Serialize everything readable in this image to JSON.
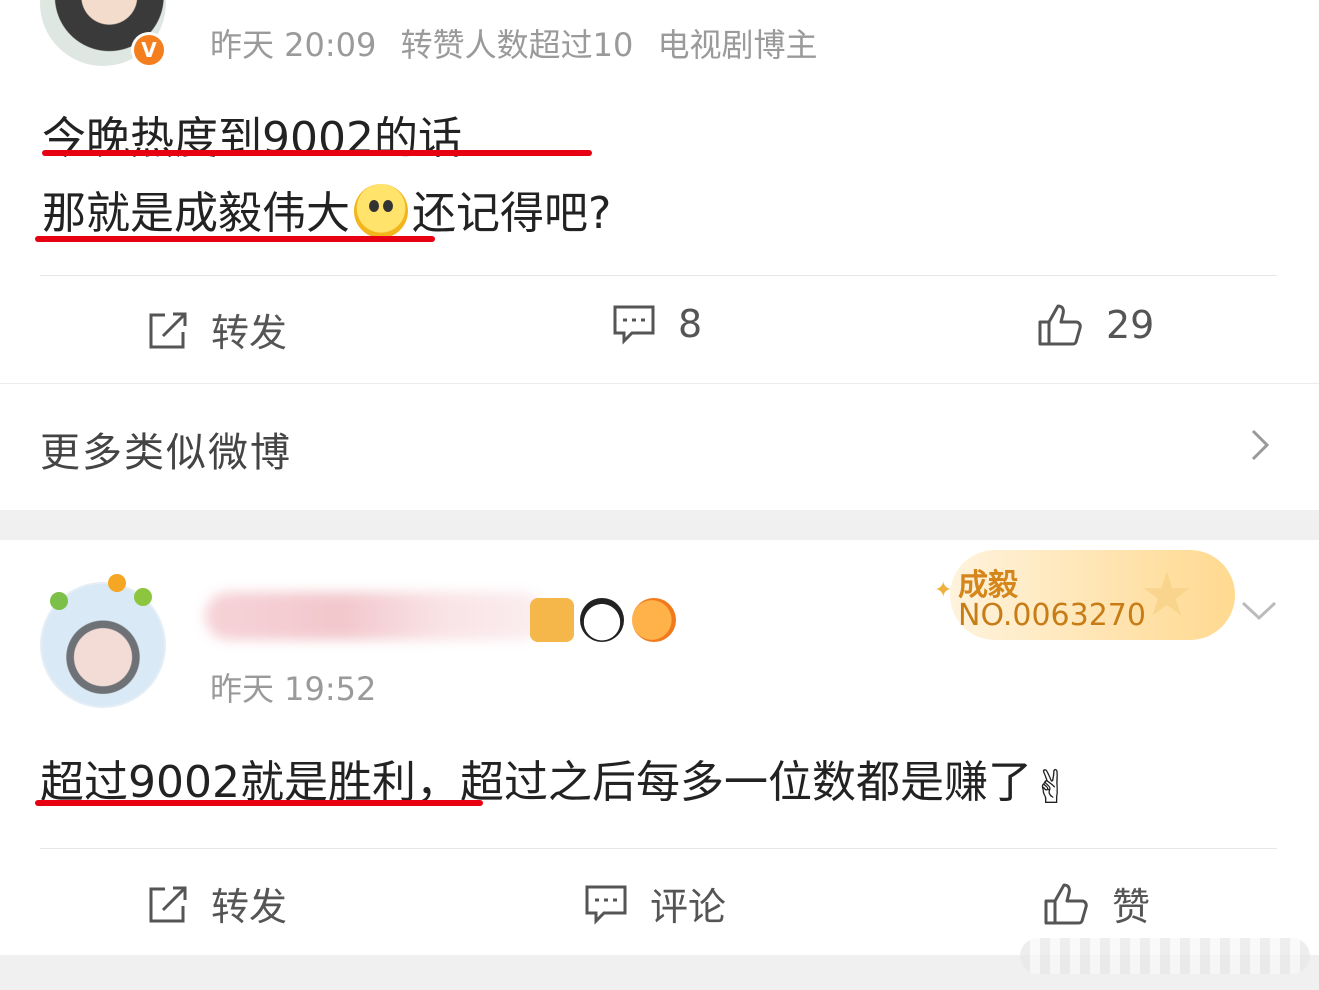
{
  "post1": {
    "meta": {
      "time": "昨天 20:09",
      "repost_note": "转赞人数超过10",
      "tag": "电视剧博主"
    },
    "verified_badge": "V",
    "content": {
      "line1": "今晚热度到9002的话",
      "line2_before": "那就是成毅伟大",
      "line2_after": "还记得吧?"
    },
    "actions": {
      "repost_label": "转发",
      "comment_count": "8",
      "like_count": "29"
    }
  },
  "more_similar": {
    "label": "更多类似微博"
  },
  "post2": {
    "fan_badge": {
      "name": "成毅",
      "number": "NO.0063270"
    },
    "meta": {
      "time": "昨天 19:52"
    },
    "content": {
      "underlined": "超过9002就是胜利",
      "rest": "，超过之后每多一位数都是赚了",
      "emoji": "✌"
    },
    "actions": {
      "repost_label": "转发",
      "comment_label": "评论",
      "like_label": "赞"
    }
  },
  "colors": {
    "underline": "#e60012",
    "meta_text": "#9a9a9a",
    "verified": "#f57f1e",
    "fan_badge": "#d4861a"
  }
}
